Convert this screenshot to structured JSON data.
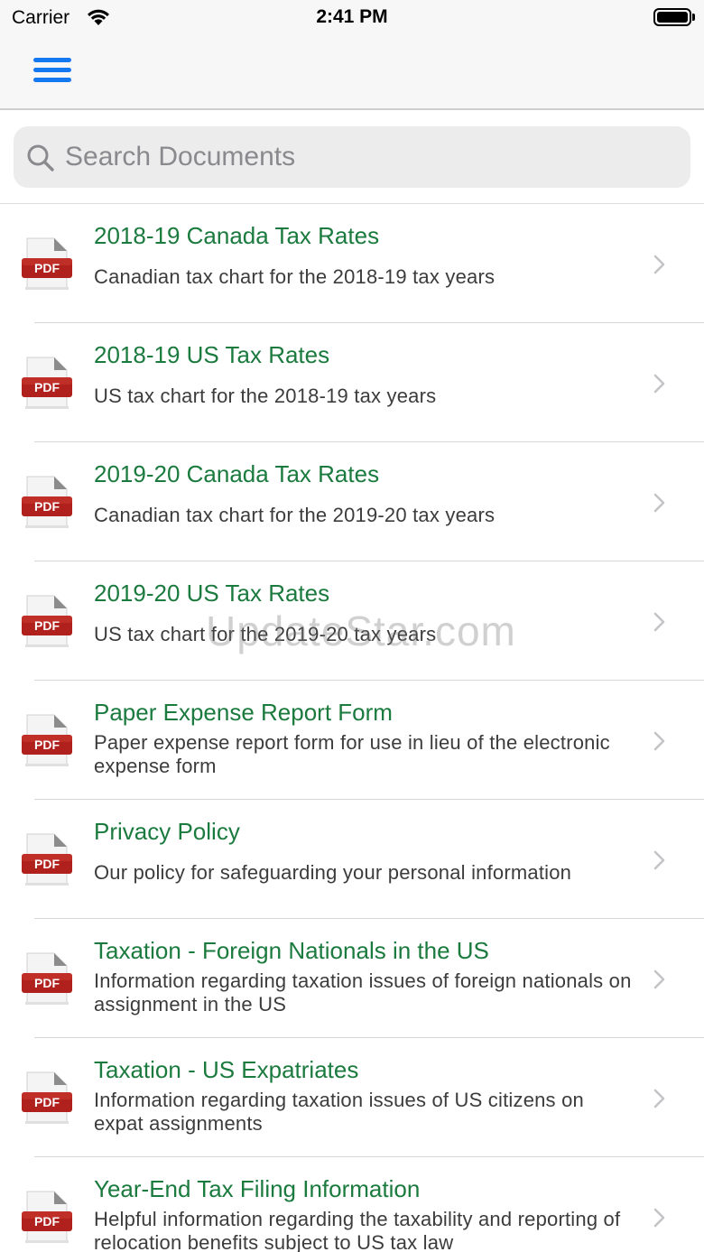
{
  "status_bar": {
    "carrier": "Carrier",
    "time": "2:41 PM"
  },
  "nav": {
    "menu_icon": "hamburger-menu-icon",
    "accent_color": "#1478f0"
  },
  "search": {
    "placeholder": "Search Documents",
    "value": ""
  },
  "documents": [
    {
      "title": "2018-19 Canada Tax Rates",
      "description": "Canadian tax chart for the 2018-19 tax years",
      "icon": "pdf-icon"
    },
    {
      "title": "2018-19 US Tax Rates",
      "description": "US tax chart for the 2018-19 tax years",
      "icon": "pdf-icon"
    },
    {
      "title": "2019-20 Canada Tax Rates",
      "description": "Canadian tax chart for the 2019-20 tax years",
      "icon": "pdf-icon"
    },
    {
      "title": "2019-20 US Tax Rates",
      "description": "US tax chart for the 2019-20 tax years",
      "icon": "pdf-icon"
    },
    {
      "title": "Paper Expense Report Form",
      "description": "Paper expense report form for use in lieu of the electronic expense form",
      "icon": "pdf-icon"
    },
    {
      "title": "Privacy Policy",
      "description": "Our policy for safeguarding your personal information",
      "icon": "pdf-icon"
    },
    {
      "title": "Taxation - Foreign Nationals in the US",
      "description": "Information regarding taxation issues of foreign nationals on assignment in the US",
      "icon": "pdf-icon"
    },
    {
      "title": "Taxation - US Expatriates",
      "description": "Information regarding taxation issues of US citizens on expat assignments",
      "icon": "pdf-icon"
    },
    {
      "title": "Year-End Tax Filing Information",
      "description": "Helpful information regarding the taxability and reporting of relocation benefits subject to US tax law",
      "icon": "pdf-icon"
    }
  ],
  "pdf_label": "PDF",
  "watermark": "UpdateStar.com",
  "colors": {
    "title_green": "#1b7a3e",
    "pdf_red": "#b0201c"
  }
}
